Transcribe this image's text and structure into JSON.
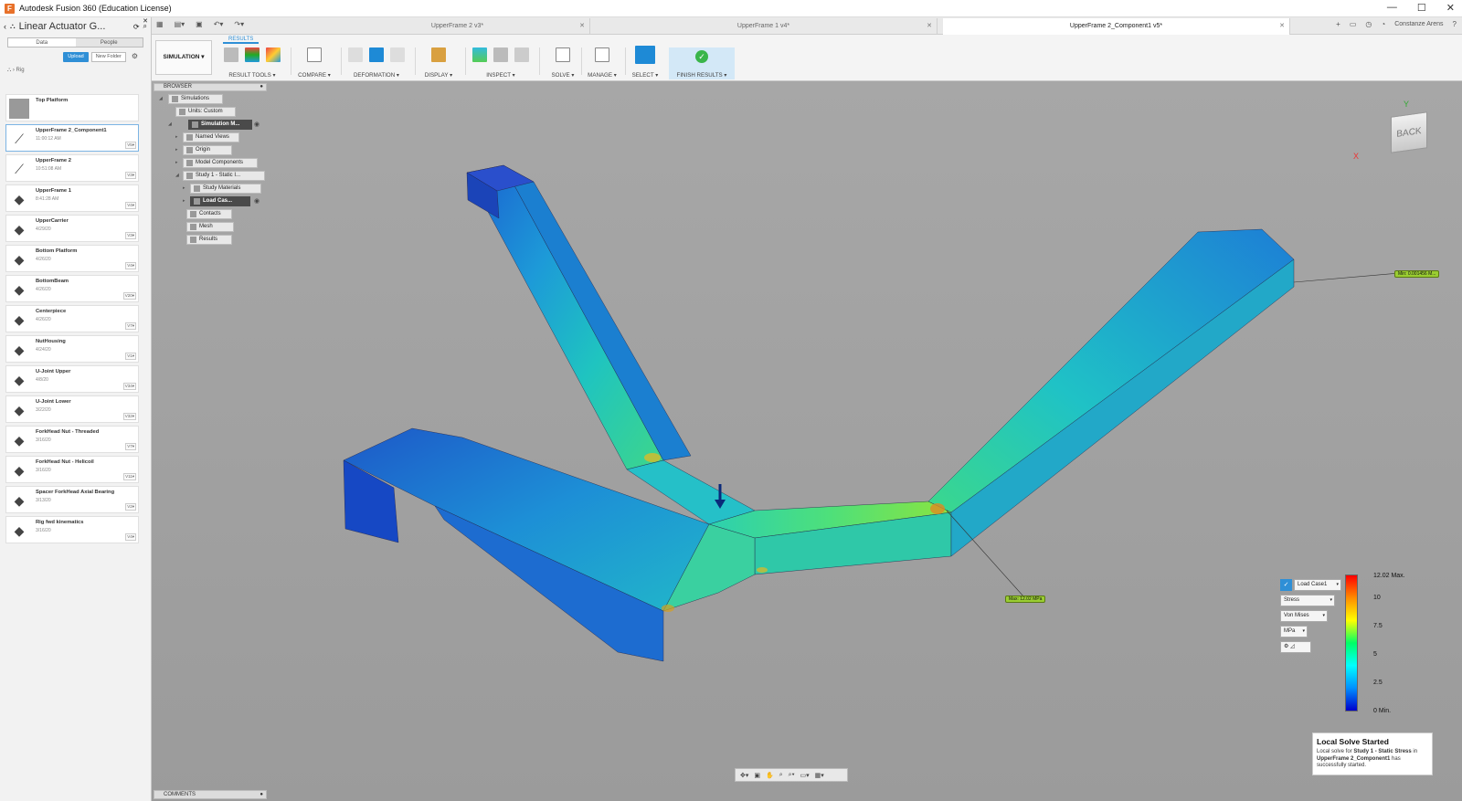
{
  "window": {
    "title": "Autodesk Fusion 360 (Education License)",
    "app_icon": "F"
  },
  "datapanel": {
    "project": "Linear Actuator G...",
    "tabs": [
      "Data",
      "People"
    ],
    "upload": "Upload",
    "new_folder": "New Folder",
    "breadcrumb": "Rig",
    "items": [
      {
        "name": "Top Platform",
        "date": "",
        "ver": "",
        "icon": "folder-icon"
      },
      {
        "name": "UpperFrame 2_Component1",
        "date": "11:00:12 AM",
        "ver": "V5▾",
        "icon": "frame-icon"
      },
      {
        "name": "UpperFrame 2",
        "date": "10:51:08 AM",
        "ver": "V3▾",
        "icon": "frame-icon"
      },
      {
        "name": "UpperFrame 1",
        "date": "8:41:28 AM",
        "ver": "V4▾",
        "icon": "part-icon"
      },
      {
        "name": "UpperCarrier",
        "date": "4/29/20",
        "ver": "V3▾",
        "icon": "part-icon"
      },
      {
        "name": "Bottom Platform",
        "date": "4/26/20",
        "ver": "V4▾",
        "icon": "part-icon"
      },
      {
        "name": "BottomBeam",
        "date": "4/26/20",
        "ver": "V20▾",
        "icon": "part-icon"
      },
      {
        "name": "Centerpiece",
        "date": "4/26/20",
        "ver": "V7▾",
        "icon": "part-icon"
      },
      {
        "name": "NutHousing",
        "date": "4/24/20",
        "ver": "V1▾",
        "icon": "part-icon"
      },
      {
        "name": "U-Joint Upper",
        "date": "4/8/20",
        "ver": "V34▾",
        "icon": "part-icon"
      },
      {
        "name": "U-Joint Lower",
        "date": "3/22/20",
        "ver": "V32▾",
        "icon": "part-icon"
      },
      {
        "name": "ForkHead Nut - Threaded",
        "date": "3/16/20",
        "ver": "V7▾",
        "icon": "part-icon"
      },
      {
        "name": "ForkHead Nut - Helicoil",
        "date": "3/16/20",
        "ver": "V11▾",
        "icon": "part-icon"
      },
      {
        "name": "Spacer ForkHead Axial Bearing",
        "date": "3/13/20",
        "ver": "V2▾",
        "icon": "part-icon"
      },
      {
        "name": "Rig fwd kinematics",
        "date": "3/16/20",
        "ver": "V4▾",
        "icon": "part-icon"
      }
    ]
  },
  "tabs": [
    {
      "label": "UpperFrame 2 v3*",
      "active": false
    },
    {
      "label": "UpperFrame 1 v4*",
      "active": false
    },
    {
      "label": "UpperFrame 2_Component1 v5*",
      "active": true
    }
  ],
  "user": "Constanze Arens",
  "toolbar": {
    "workspace_tab": "RESULTS",
    "workspace": "SIMULATION ▾",
    "groups": [
      {
        "label": "RESULT TOOLS ▾"
      },
      {
        "label": "COMPARE ▾"
      },
      {
        "label": "DEFORMATION ▾"
      },
      {
        "label": "DISPLAY ▾"
      },
      {
        "label": "INSPECT ▾"
      },
      {
        "label": "SOLVE ▾"
      },
      {
        "label": "MANAGE ▾"
      },
      {
        "label": "SELECT ▾"
      },
      {
        "label": "FINISH RESULTS ▾"
      }
    ]
  },
  "browser": {
    "title": "BROWSER",
    "rows": [
      "Simulations",
      "Units: Custom",
      "Simulation M...",
      "Named Views",
      "Origin",
      "Model Components",
      "Study 1 - Static I...",
      "Study Materials",
      "Load Cas...",
      "Contacts",
      "Mesh",
      "Results"
    ],
    "comments": "COMMENTS"
  },
  "viewcube": {
    "face": "BACK",
    "axis_x": "X",
    "axis_y": "Y"
  },
  "legend": {
    "load_case": "Load Case1",
    "result": "Stress",
    "type": "Von Mises",
    "unit": "MPa",
    "max_label": "12.02 Max.",
    "min_label": "0 Min.",
    "ticks": [
      "10",
      "7.5",
      "5",
      "2.5"
    ],
    "colors": [
      "#ff0000",
      "#ff8c00",
      "#ffff00",
      "#00ff66",
      "#00ffff",
      "#0090ff",
      "#0000cc"
    ]
  },
  "probes": {
    "max": "Max: 12.02 MPa",
    "min": "Min: 0.001456 M..."
  },
  "notification": {
    "title": "Local Solve Started",
    "body_prefix": "Local solve for",
    "study": "Study 1 - Static Stress",
    "body_mid": "in",
    "component": "UpperFrame 2_Component1",
    "body_suffix": "has successfully started."
  }
}
